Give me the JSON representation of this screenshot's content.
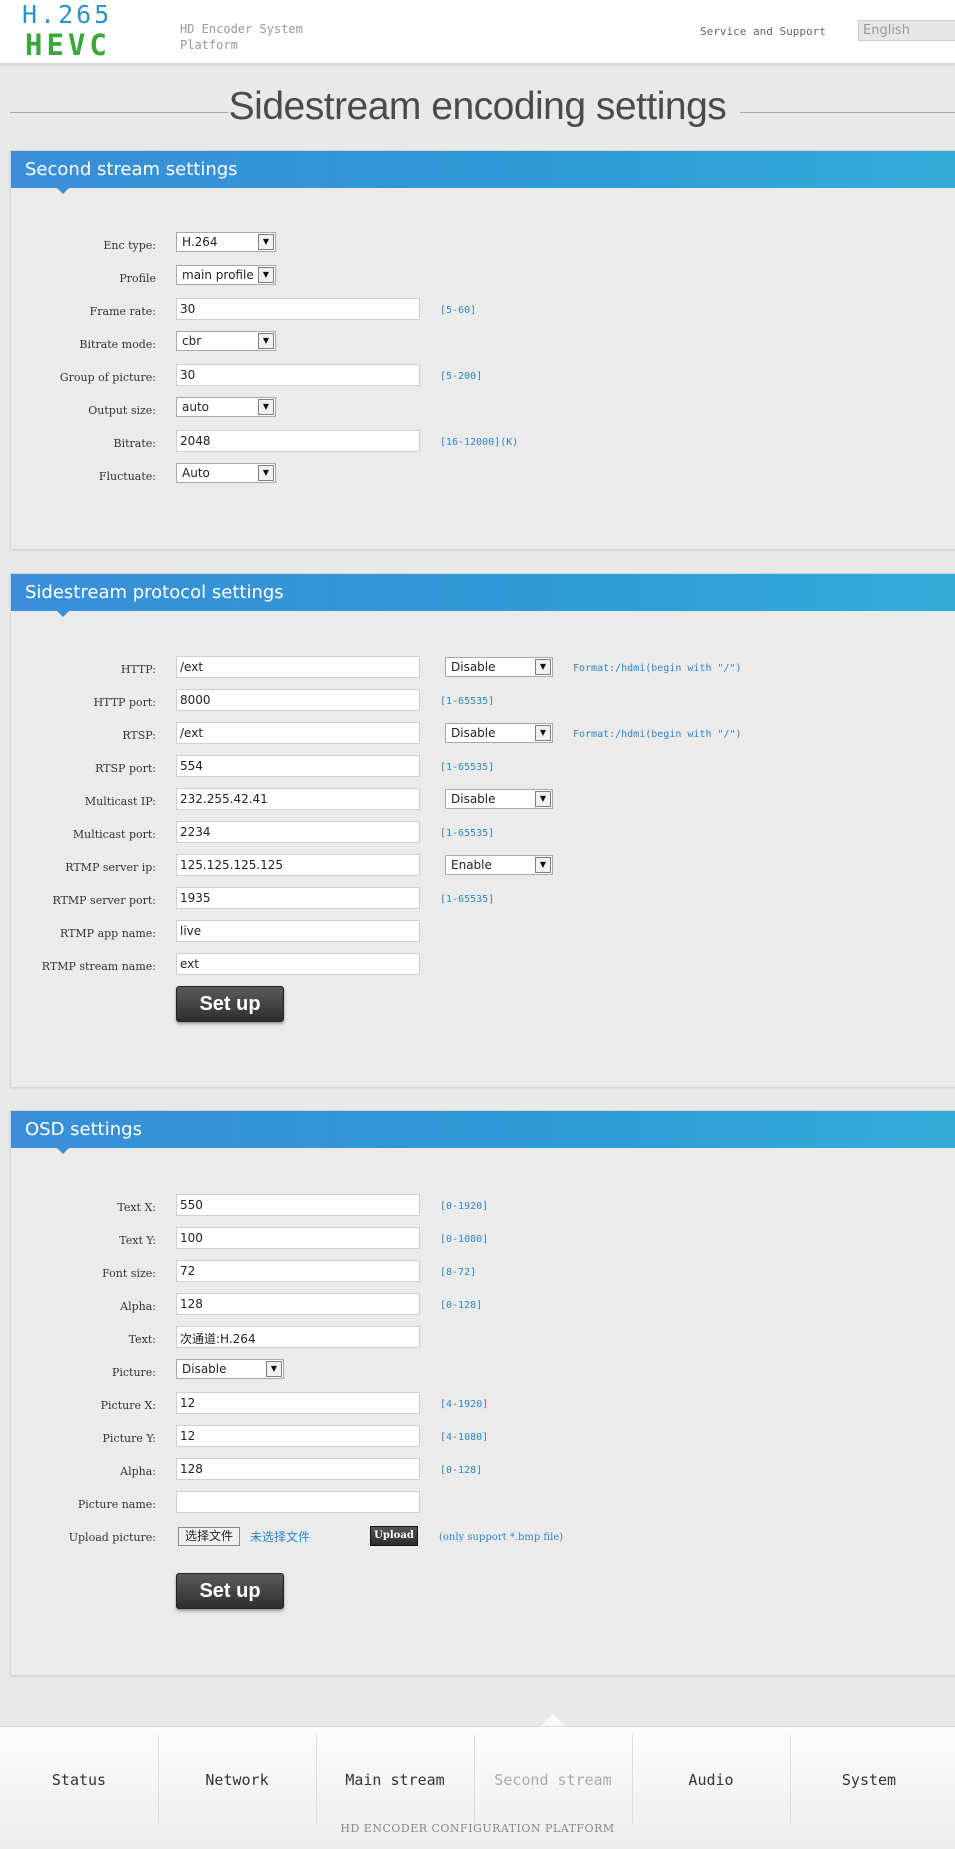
{
  "header": {
    "logo_top": "H.265",
    "logo_bottom": "HEVC",
    "platform": "HD Encoder System Platform",
    "service": "Service and Support",
    "language": "English"
  },
  "page_title": "Sidestream encoding settings",
  "second_stream": {
    "title": "Second stream settings",
    "enc_type_label": "Enc type:",
    "enc_type": "H.264",
    "profile_label": "Profile",
    "profile": "main profile",
    "frame_rate_label": "Frame rate:",
    "frame_rate": "30",
    "frame_rate_range": "[5-60]",
    "bitrate_mode_label": "Bitrate mode:",
    "bitrate_mode": "cbr",
    "gop_label": "Group of picture:",
    "gop": "30",
    "gop_range": "[5-200]",
    "output_size_label": "Output size:",
    "output_size": "auto",
    "bitrate_label": "Bitrate:",
    "bitrate": "2048",
    "bitrate_range": "[16-12000](K)",
    "fluctuate_label": "Fluctuate:",
    "fluctuate": "Auto"
  },
  "protocol": {
    "title": "Sidestream protocol settings",
    "http_label": "HTTP:",
    "http": "/ext",
    "http_state": "Disable",
    "http_format": "Format:/hdmi(begin with \"/\")",
    "http_port_label": "HTTP port:",
    "http_port": "8000",
    "http_port_range": "[1-65535]",
    "rtsp_label": "RTSP:",
    "rtsp": "/ext",
    "rtsp_state": "Disable",
    "rtsp_format": "Format:/hdmi(begin with \"/\")",
    "rtsp_port_label": "RTSP port:",
    "rtsp_port": "554",
    "rtsp_port_range": "[1-65535]",
    "multicast_ip_label": "Multicast IP:",
    "multicast_ip": "232.255.42.41",
    "multicast_state": "Disable",
    "multicast_port_label": "Multicast port:",
    "multicast_port": "2234",
    "multicast_port_range": "[1-65535]",
    "rtmp_ip_label": "RTMP server ip:",
    "rtmp_ip": "125.125.125.125",
    "rtmp_state": "Enable",
    "rtmp_port_label": "RTMP server port:",
    "rtmp_port": "1935",
    "rtmp_port_range": "[1-65535]",
    "rtmp_app_label": "RTMP app name:",
    "rtmp_app": "live",
    "rtmp_stream_label": "RTMP stream name:",
    "rtmp_stream": "ext",
    "setup": "Set up"
  },
  "osd": {
    "title": "OSD settings",
    "text_x_label": "Text X:",
    "text_x": "550",
    "text_x_range": "[0-1920]",
    "text_y_label": "Text Y:",
    "text_y": "100",
    "text_y_range": "[0-1080]",
    "font_size_label": "Font size:",
    "font_size": "72",
    "font_size_range": "[8-72]",
    "alpha_label": "Alpha:",
    "alpha": "128",
    "alpha_range": "[0-128]",
    "text_label": "Text:",
    "text": "次通道:H.264",
    "picture_label": "Picture:",
    "picture": "Disable",
    "picture_x_label": "Picture X:",
    "picture_x": "12",
    "picture_x_range": "[4-1920]",
    "picture_y_label": "Picture Y:",
    "picture_y": "12",
    "picture_y_range": "[4-1080]",
    "alpha2_label": "Alpha:",
    "alpha2": "128",
    "alpha2_range": "[0-128]",
    "picture_name_label": "Picture name:",
    "picture_name": "",
    "upload_label": "Upload picture:",
    "choose_file": "选择文件",
    "no_file": "未选择文件",
    "upload": "Upload",
    "upload_hint": "(only support *.bmp file)",
    "setup": "Set up"
  },
  "nav": {
    "items": [
      "Status",
      "Network",
      "Main stream",
      "Second stream",
      "Audio",
      "System"
    ],
    "active_index": 3
  },
  "footer": "HD ENCODER CONFIGURATION PLATFORM"
}
